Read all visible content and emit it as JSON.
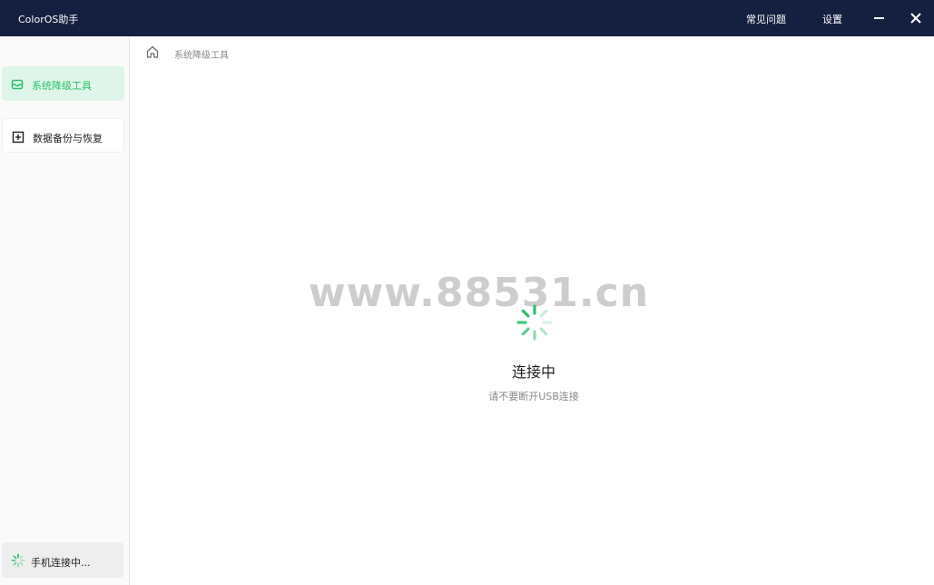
{
  "window": {
    "title": "ColorOS助手",
    "faq_label": "常见问题",
    "settings_label": "设置",
    "minimize_icon": "minimize-icon",
    "close_icon": "close-icon"
  },
  "sidebar": {
    "items": [
      {
        "label": "系统降级工具",
        "icon": "inbox-tray-icon",
        "active": true
      },
      {
        "label": "数据备份与恢复",
        "icon": "plus-square-icon",
        "active": false
      }
    ],
    "phone_status": "手机连接中...",
    "accent_color": "#2bbf6a"
  },
  "breadcrumb": {
    "home_icon": "home-icon",
    "current": "系统降级工具"
  },
  "main": {
    "watermark": "www.88531.cn",
    "status_title": "连接中",
    "status_subtitle": "请不要断开USB连接",
    "loader_icon": "loading-spinner-icon"
  }
}
